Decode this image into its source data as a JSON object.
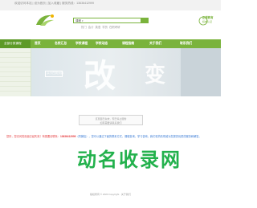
{
  "topbar": {
    "text": "欢迎访问本站 | 设为首页 | 加入收藏 | 服务热线：13636412999"
  },
  "search": {
    "select_label": "课程",
    "button_label": ""
  },
  "hot_keywords": [
    "热门",
    "会计",
    "英语",
    "学历",
    "在职考研"
  ],
  "right_logo": {
    "line1": "正规教育",
    "line2": "权威认证"
  },
  "nav": {
    "category_label": "全部分类课程",
    "items": [
      "首页",
      "名校汇总",
      "学校课程",
      "学校动态",
      "课程指南",
      "关于我们",
      "联系我们"
    ]
  },
  "banner": {
    "badge_text": "从小白到大咖",
    "big_word": "改",
    "big_word2": "变"
  },
  "notice": {
    "line1": "该页面已失效，现已停止服务",
    "line2": "如有需要请联系我们"
  },
  "contact": {
    "part1": "您好，您访问的页面已经失效！有需要请联系：",
    "phone": "13636412999",
    "part2": "（同微信），您可以通过下面的联系方式，课程查询，学习咨询，我们将热情竭诚为您提供优质的服务和解答。"
  },
  "watermark": "动名收录网",
  "footer": "版权所有 © 2024 Copyright · 关于我们"
}
